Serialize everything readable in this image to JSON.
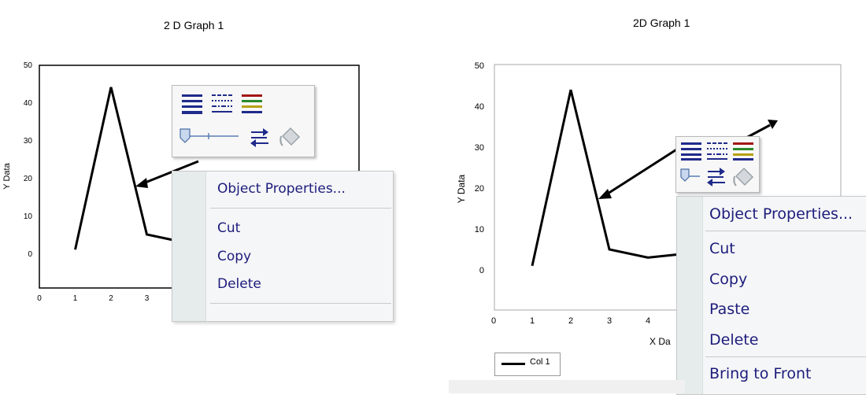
{
  "left": {
    "title": "2 D Graph 1",
    "y_axis_label": "Y Data",
    "y_ticks": [
      "50",
      "40",
      "30",
      "20",
      "10",
      "0"
    ],
    "x_ticks": [
      "0",
      "1",
      "2",
      "3"
    ],
    "context_menu": {
      "items": [
        "Object Properties...",
        "Cut",
        "Copy",
        "Delete"
      ]
    },
    "toolbar_icons": [
      "line-style-icon",
      "dash-style-icon",
      "line-color-icon",
      "line-thickness-slider-icon",
      "line-arrows-icon",
      "fill-bucket-icon"
    ]
  },
  "right": {
    "title": "2D Graph 1",
    "y_axis_label": "Y Data",
    "x_axis_label": "X Da",
    "y_ticks": [
      "50",
      "40",
      "30",
      "20",
      "10",
      "0"
    ],
    "x_ticks": [
      "0",
      "1",
      "2",
      "3",
      "4"
    ],
    "legend_label": "Col 1",
    "context_menu": {
      "items": [
        "Object Properties...",
        "Cut",
        "Copy",
        "Paste",
        "Delete",
        "Bring to Front"
      ]
    },
    "toolbar_icons": [
      "line-style-icon",
      "dash-style-icon",
      "line-color-icon",
      "line-thickness-slider-icon",
      "line-arrows-icon",
      "fill-bucket-icon"
    ]
  },
  "chart_data": [
    {
      "type": "line",
      "title": "2 D Graph 1",
      "ylabel": "Y Data",
      "xlabel": "",
      "xlim": [
        0,
        4
      ],
      "ylim": [
        -5,
        50
      ],
      "series": [
        {
          "x": [
            1,
            2,
            3,
            4
          ],
          "y": [
            1,
            44,
            5,
            3
          ]
        }
      ]
    },
    {
      "type": "line",
      "title": "2D Graph 1",
      "ylabel": "Y Data",
      "xlabel": "X Da",
      "xlim": [
        0,
        5
      ],
      "ylim": [
        -5,
        50
      ],
      "series": [
        {
          "name": "Col 1",
          "x": [
            1,
            2,
            3,
            4,
            5
          ],
          "y": [
            1,
            44,
            5,
            3,
            4
          ]
        }
      ]
    }
  ],
  "colors": {
    "menu_text": "#1c1c7c",
    "menu_gutter": "#e6ebeb",
    "toolbar_blue": "#1f2a8a",
    "line_color": "#000000"
  }
}
